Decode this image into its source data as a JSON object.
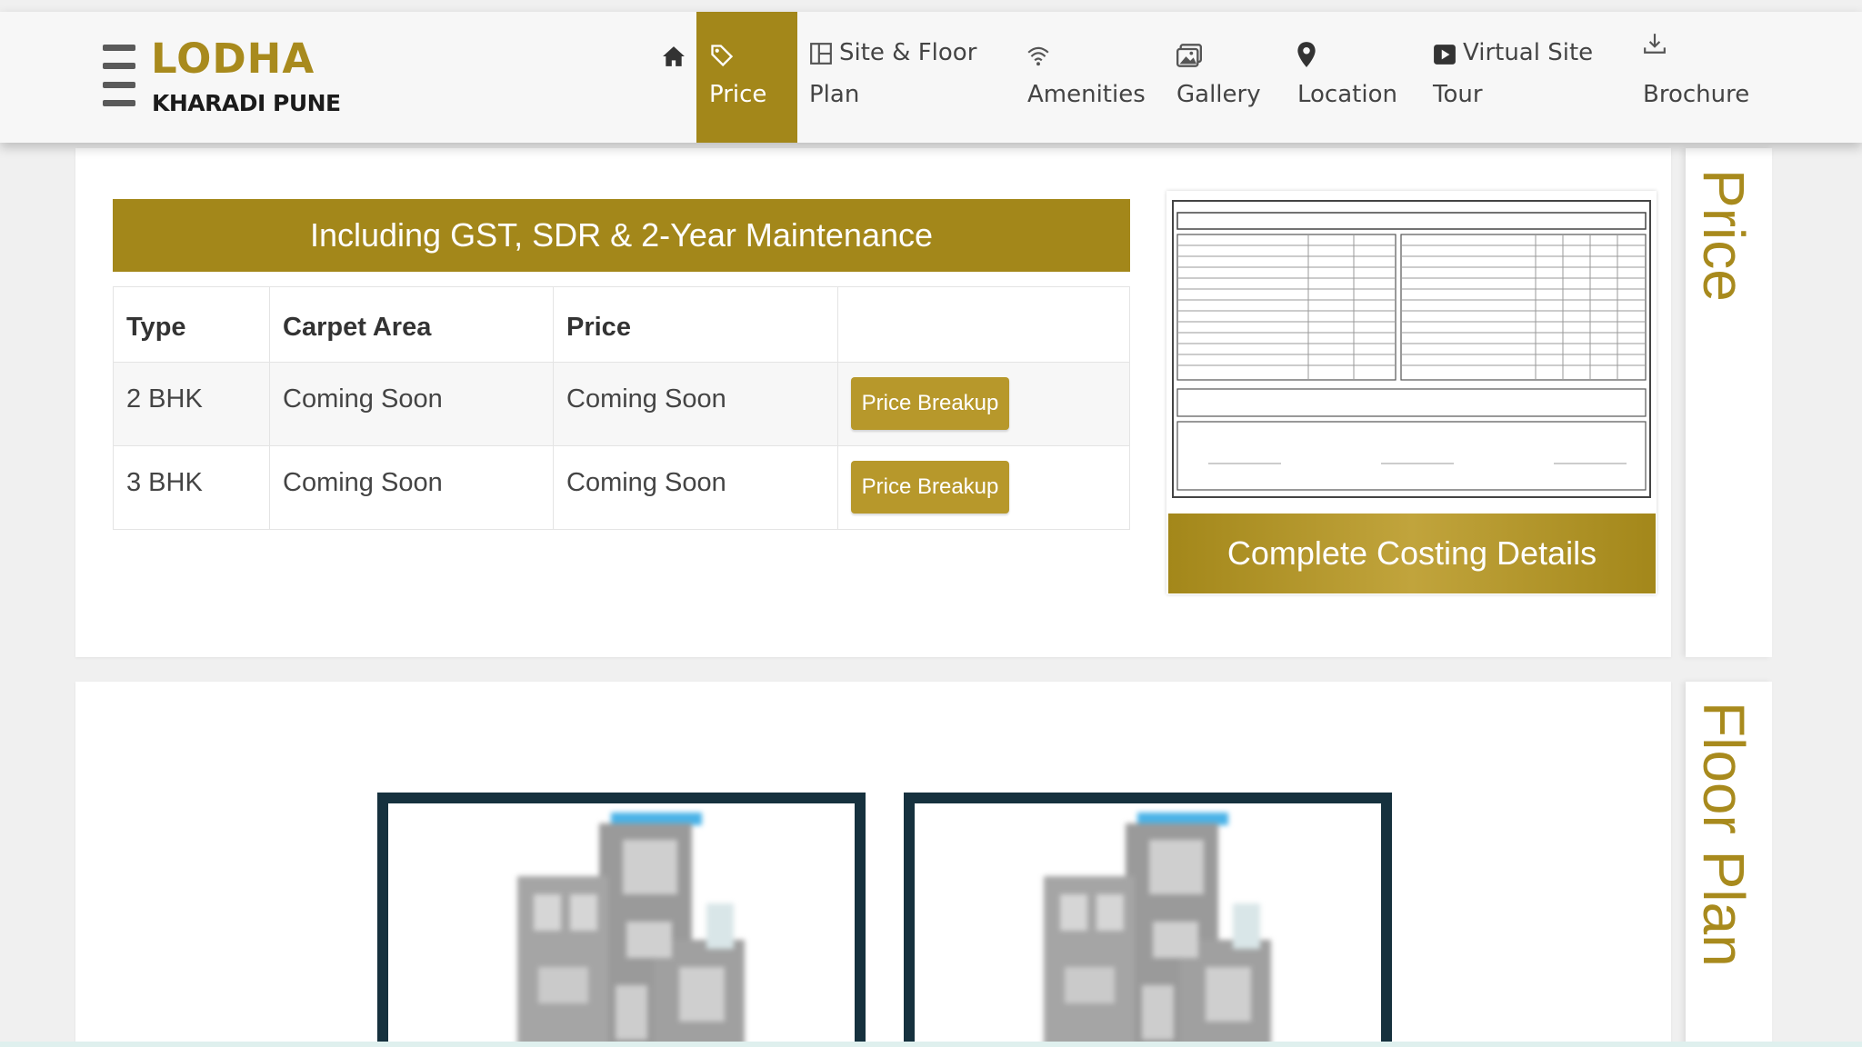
{
  "header": {
    "logo": {
      "brand": "LODHA",
      "location": "KHARADI PUNE"
    },
    "nav": [
      {
        "id": "home",
        "icon": "home-icon",
        "line1": "",
        "line2": ""
      },
      {
        "id": "price",
        "icon": "price-tag-icon",
        "line1": "",
        "line2": "Price",
        "active": true
      },
      {
        "id": "site-floor-plan",
        "icon": "floor-plan-icon",
        "line1": "Site & Floor",
        "line2": "Plan"
      },
      {
        "id": "amenities",
        "icon": "wifi-icon",
        "line1": "",
        "line2": "Amenities"
      },
      {
        "id": "gallery",
        "icon": "gallery-icon",
        "line1": "",
        "line2": "Gallery"
      },
      {
        "id": "location",
        "icon": "map-pin-icon",
        "line1": "",
        "line2": "Location"
      },
      {
        "id": "virtual-tour",
        "icon": "video-play-icon",
        "line1": "Virtual Site",
        "line2": "Tour"
      },
      {
        "id": "brochure",
        "icon": "download-icon",
        "line1": "",
        "line2": "Brochure"
      }
    ]
  },
  "price_section": {
    "side_title": "Price",
    "banner": "Including GST, SDR & 2-Year Maintenance",
    "table": {
      "headers": [
        "Type",
        "Carpet Area",
        "Price",
        ""
      ],
      "rows": [
        {
          "type": "2 BHK",
          "carpet_area": "Coming Soon",
          "price": "Coming Soon",
          "action": "Price Breakup"
        },
        {
          "type": "3 BHK",
          "carpet_area": "Coming Soon",
          "price": "Coming Soon",
          "action": "Price Breakup"
        }
      ]
    },
    "costing_button": "Complete Costing Details"
  },
  "floor_plan_section": {
    "side_title": "Floor Plan"
  },
  "colors": {
    "accent_gold": "#a3871a",
    "frame_dark": "#16313e",
    "background": "#f0f0f0"
  }
}
